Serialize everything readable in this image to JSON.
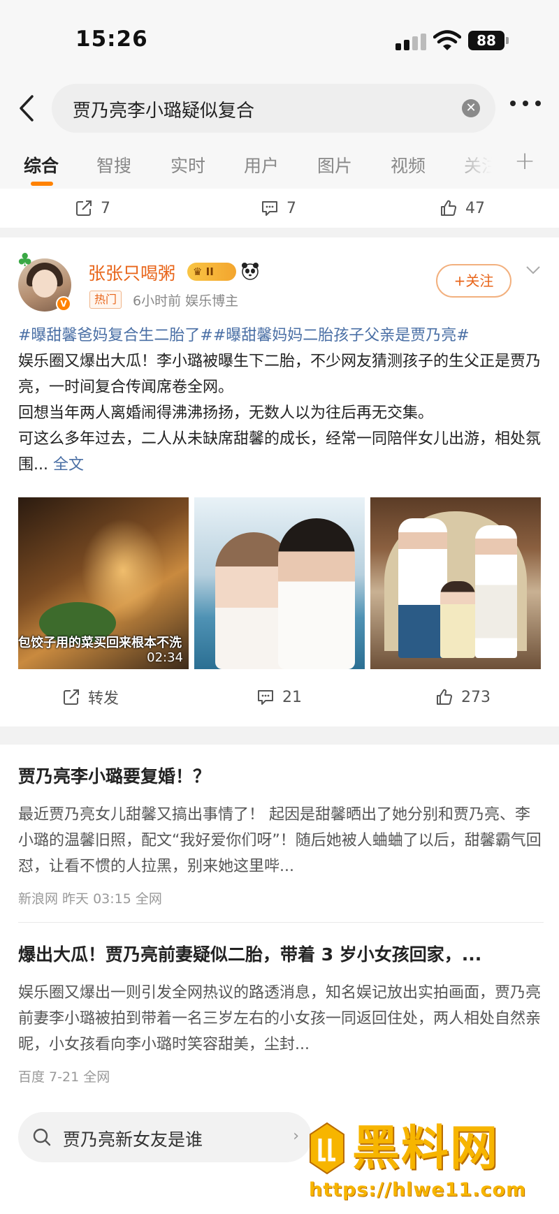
{
  "status_bar": {
    "time": "15:26",
    "battery": "88"
  },
  "search": {
    "query": "贾乃亮李小璐疑似复合"
  },
  "tabs": [
    {
      "label": "综合"
    },
    {
      "label": "智搜"
    },
    {
      "label": "实时"
    },
    {
      "label": "用户"
    },
    {
      "label": "图片"
    },
    {
      "label": "视频"
    },
    {
      "label": "关注"
    }
  ],
  "prev_post_actions": {
    "repost": "7",
    "comment": "7",
    "like": "47"
  },
  "post": {
    "author": "张张只喝粥",
    "level": "II",
    "tag": "热门",
    "time": "6小时前  娱乐博主",
    "follow_label": "+关注",
    "hashtags": "#曝甜馨爸妈复合生二胎了##曝甜馨妈妈二胎孩子父亲是贾乃亮#",
    "lines": [
      "娱乐圈又爆出大瓜！李小璐被曝生下二胎，不少网友猜测孩子的生父正是贾乃亮，一时间复合传闻席卷全网。",
      "回想当年两人离婚闹得沸沸扬扬，无数人以为往后再无交集。",
      "可这么多年过去，二人从未缺席甜馨的成长，经常一同陪伴女儿出游，相处氛围... "
    ],
    "full_text_label": "全文",
    "video_caption": "包饺子用的菜买回来根本不洗",
    "video_duration": "02:34",
    "actions": {
      "repost": "转发",
      "comment": "21",
      "like": "273"
    }
  },
  "news": [
    {
      "title": "贾乃亮李小璐要复婚！？",
      "summary": "最近贾乃亮女儿甜馨又搞出事情了！        起因是甜馨晒出了她分别和贾乃亮、李小璐的温馨旧照，配文“我好爱你们呀”！随后她被人蛐蛐了以后，甜馨霸气回怼，让看不惯的人拉黑，别来她这里哔...",
      "meta": "新浪网  昨天 03:15  全网"
    },
    {
      "title": "爆出大瓜！贾乃亮前妻疑似二胎，带着 3 岁小女孩回家，...",
      "summary": "娱乐圈又爆出一则引发全网热议的路透消息，知名娱记放出实拍画面，贾乃亮前妻李小璐被拍到带着一名三岁左右的小女孩一同返回住处，两人相处自然亲昵，小女孩看向李小璐时笑容甜美，尘封...",
      "meta": "百度  7-21  全网"
    }
  ],
  "bottom_search": {
    "text": "贾乃亮新女友是谁"
  },
  "watermark": {
    "title": "黑料网",
    "url": "https://hlwe11.com"
  },
  "colors": {
    "accent": "#ff8200",
    "link": "#4a6fa5",
    "author": "#e8651a",
    "watermark": "#f7b500"
  }
}
